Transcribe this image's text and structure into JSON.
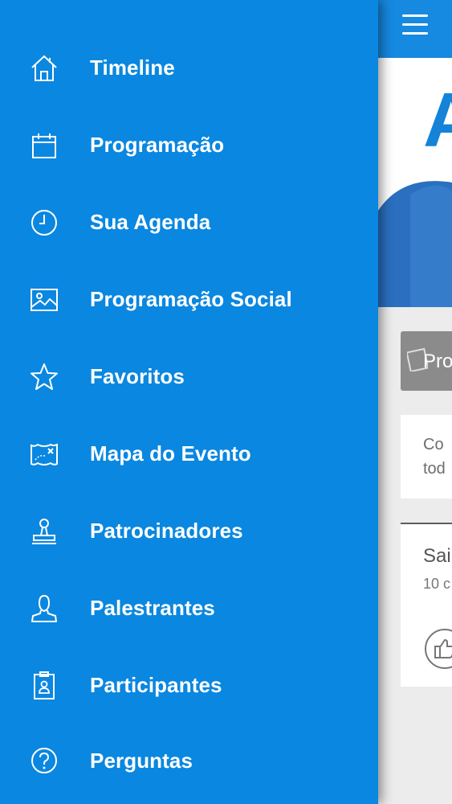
{
  "drawer": {
    "items": [
      {
        "label": "Timeline",
        "icon": "home-icon"
      },
      {
        "label": "Programação",
        "icon": "calendar-icon"
      },
      {
        "label": "Sua Agenda",
        "icon": "clock-icon"
      },
      {
        "label": "Programação Social",
        "icon": "image-icon"
      },
      {
        "label": "Favoritos",
        "icon": "star-icon"
      },
      {
        "label": "Mapa do Evento",
        "icon": "map-icon"
      },
      {
        "label": "Patrocinadores",
        "icon": "stamp-icon"
      },
      {
        "label": "Palestrantes",
        "icon": "person-icon"
      },
      {
        "label": "Participantes",
        "icon": "badge-icon"
      },
      {
        "label": "Perguntas",
        "icon": "question-icon"
      }
    ]
  },
  "main": {
    "banner_letter": "A",
    "card_title": "Pro",
    "card_text_line1": "Co",
    "card_text_line2": "tod",
    "post_title": "Sai",
    "post_date": "10 c"
  },
  "colors": {
    "drawer_bg": "#0a87e0",
    "topbar_bg": "#1689e0",
    "banner_accent": "#1483d8"
  }
}
